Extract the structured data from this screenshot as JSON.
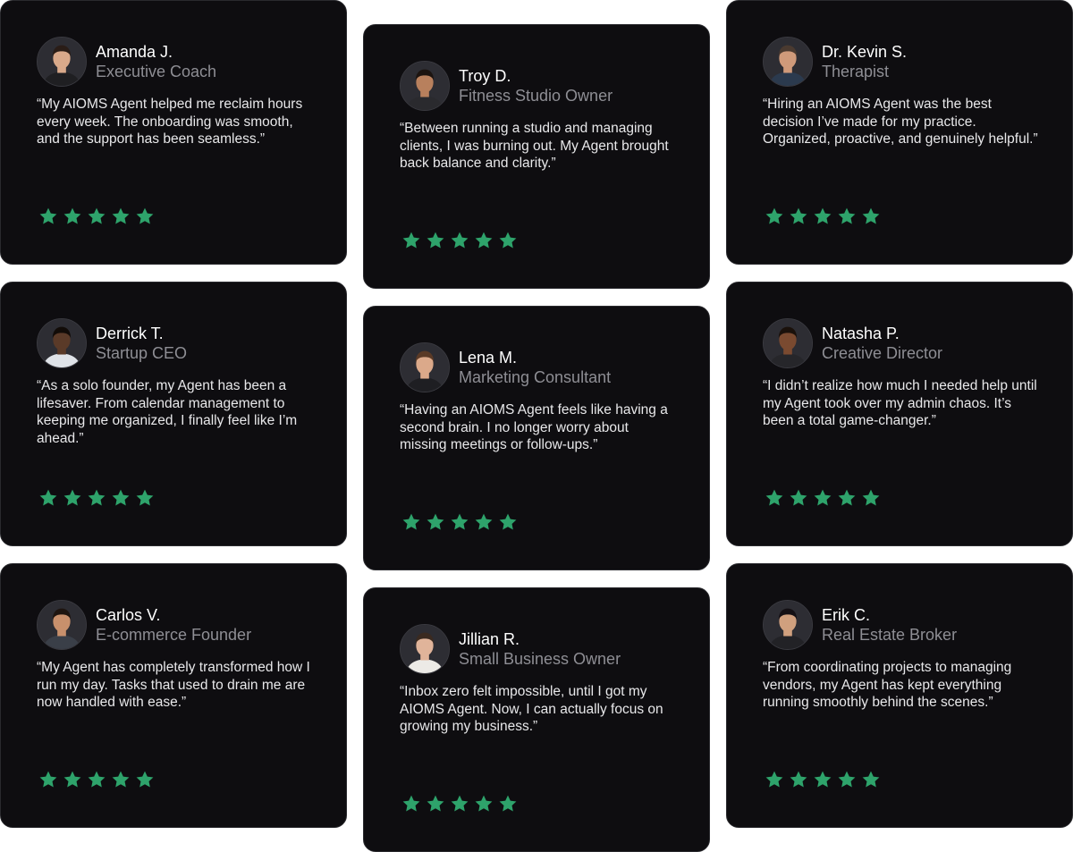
{
  "colors": {
    "star": "#2ea36b",
    "card": "#0e0d10"
  },
  "testimonials": [
    {
      "name": "Amanda J.",
      "role": "Executive Coach",
      "quote": "“My AIOMS Agent helped me reclaim hours every week. The onboarding was smooth, and the support has been seamless.”",
      "rating": 5,
      "avatar": {
        "skin": "#d9a98a",
        "hair": "#2a1d17",
        "shirt": "#1f1f22"
      }
    },
    {
      "name": "Troy D.",
      "role": "Fitness Studio Owner",
      "quote": "“Between running a studio and managing clients, I was burning out. My Agent brought back balance and clarity.”",
      "rating": 5,
      "avatar": {
        "skin": "#b8805d",
        "hair": "#1c1410",
        "shirt": "#2a2a2e"
      }
    },
    {
      "name": "Dr. Kevin S.",
      "role": "Therapist",
      "quote": "“Hiring an AIOMS Agent was the best decision I’ve made for my practice. Organized, proactive, and genuinely helpful.”",
      "rating": 5,
      "avatar": {
        "skin": "#cf9a7a",
        "hair": "#4a3a30",
        "shirt": "#2b3a4e"
      }
    },
    {
      "name": "Derrick T.",
      "role": "Startup CEO",
      "quote": "“As a solo founder, my Agent has been a lifesaver. From calendar management to keeping me organized, I finally feel like I’m ahead.”",
      "rating": 5,
      "avatar": {
        "skin": "#5a3a28",
        "hair": "#120c08",
        "shirt": "#dfe3e8"
      }
    },
    {
      "name": "Lena M.",
      "role": "Marketing Consultant",
      "quote": "“Having an AIOMS Agent feels like having a second brain. I no longer worry about missing meetings or follow-ups.”",
      "rating": 5,
      "avatar": {
        "skin": "#dba98a",
        "hair": "#5a3a26",
        "shirt": "#1e1e22"
      }
    },
    {
      "name": "Natasha P.",
      "role": "Creative Director",
      "quote": "“I didn’t realize how much I needed help until my Agent took over my admin chaos. It’s been a total game-changer.”",
      "rating": 5,
      "avatar": {
        "skin": "#7a4a30",
        "hair": "#1a110b",
        "shirt": "#26262a"
      }
    },
    {
      "name": "Carlos V.",
      "role": "E-commerce Founder",
      "quote": "“My Agent has completely transformed how I run my day. Tasks that used to drain me are now handled with ease.”",
      "rating": 5,
      "avatar": {
        "skin": "#c8906c",
        "hair": "#1e1510",
        "shirt": "#3a3f48"
      }
    },
    {
      "name": "Jillian R.",
      "role": "Small Business Owner",
      "quote": "“Inbox zero felt impossible, until I got my AIOMS Agent. Now, I can actually focus on growing my business.”",
      "rating": 5,
      "avatar": {
        "skin": "#e0b49a",
        "hair": "#3a2a20",
        "shirt": "#eceae6"
      }
    },
    {
      "name": "Erik C.",
      "role": "Real Estate Broker",
      "quote": "“From coordinating projects to managing vendors, my Agent has kept everything running smoothly behind the scenes.”",
      "rating": 5,
      "avatar": {
        "skin": "#d0a07e",
        "hair": "#141014",
        "shirt": "#222226"
      }
    }
  ]
}
